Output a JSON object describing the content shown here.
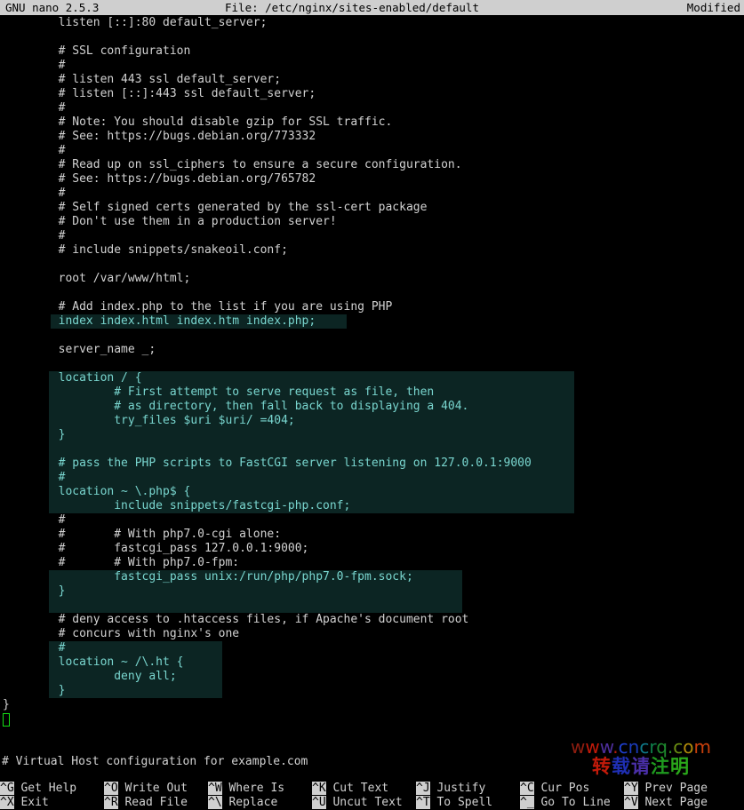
{
  "titlebar": {
    "app": "GNU nano 2.5.3",
    "file": "File: /etc/nginx/sites-enabled/default",
    "state": "Modified"
  },
  "editor": {
    "lines": [
      {
        "text": "        listen [::]:80 default_server;",
        "hl": false
      },
      {
        "text": "",
        "hl": false
      },
      {
        "text": "        # SSL configuration",
        "hl": false
      },
      {
        "text": "        #",
        "hl": false
      },
      {
        "text": "        # listen 443 ssl default_server;",
        "hl": false
      },
      {
        "text": "        # listen [::]:443 ssl default_server;",
        "hl": false
      },
      {
        "text": "        #",
        "hl": false
      },
      {
        "text": "        # Note: You should disable gzip for SSL traffic.",
        "hl": false
      },
      {
        "text": "        # See: https://bugs.debian.org/773332",
        "hl": false
      },
      {
        "text": "        #",
        "hl": false
      },
      {
        "text": "        # Read up on ssl_ciphers to ensure a secure configuration.",
        "hl": false
      },
      {
        "text": "        # See: https://bugs.debian.org/765782",
        "hl": false
      },
      {
        "text": "        #",
        "hl": false
      },
      {
        "text": "        # Self signed certs generated by the ssl-cert package",
        "hl": false
      },
      {
        "text": "        # Don't use them in a production server!",
        "hl": false
      },
      {
        "text": "        #",
        "hl": false
      },
      {
        "text": "        # include snippets/snakeoil.conf;",
        "hl": false
      },
      {
        "text": "",
        "hl": false
      },
      {
        "text": "        root /var/www/html;",
        "hl": false
      },
      {
        "text": "",
        "hl": false
      },
      {
        "text": "        # Add index.php to the list if you are using PHP",
        "hl": false
      },
      {
        "text": "        index index.html index.htm index.php;",
        "hl": true
      },
      {
        "text": "",
        "hl": false
      },
      {
        "text": "        server_name _;",
        "hl": false
      },
      {
        "text": "",
        "hl": false
      },
      {
        "text": "        location / {",
        "hl": true
      },
      {
        "text": "                # First attempt to serve request as file, then",
        "hl": true
      },
      {
        "text": "                # as directory, then fall back to displaying a 404.",
        "hl": true
      },
      {
        "text": "                try_files $uri $uri/ =404;",
        "hl": true
      },
      {
        "text": "        }",
        "hl": true
      },
      {
        "text": "",
        "hl": true
      },
      {
        "text": "        # pass the PHP scripts to FastCGI server listening on 127.0.0.1:9000",
        "hl": true
      },
      {
        "text": "        #",
        "hl": true
      },
      {
        "text": "        location ~ \\.php$ {",
        "hl": true
      },
      {
        "text": "                include snippets/fastcgi-php.conf;",
        "hl": true
      },
      {
        "text": "        #",
        "hl": false
      },
      {
        "text": "        #       # With php7.0-cgi alone:",
        "hl": false
      },
      {
        "text": "        #       fastcgi_pass 127.0.0.1:9000;",
        "hl": false
      },
      {
        "text": "        #       # With php7.0-fpm:",
        "hl": false
      },
      {
        "text": "                fastcgi_pass unix:/run/php/php7.0-fpm.sock;",
        "hl": true
      },
      {
        "text": "        }",
        "hl": true
      },
      {
        "text": "",
        "hl": true
      },
      {
        "text": "        # deny access to .htaccess files, if Apache's document root",
        "hl": false
      },
      {
        "text": "        # concurs with nginx's one",
        "hl": false
      },
      {
        "text": "        #",
        "hl": true
      },
      {
        "text": "        location ~ /\\.ht {",
        "hl": true
      },
      {
        "text": "                deny all;",
        "hl": true
      },
      {
        "text": "        }",
        "hl": true
      },
      {
        "text": "}",
        "hl": false
      },
      {
        "text": "",
        "hl": false
      }
    ],
    "cursor": {
      "line": 49,
      "col": 0
    }
  },
  "statusline": {
    "text": "# Virtual Host configuration for example.com"
  },
  "watermark": {
    "line1": [
      {
        "ch": "w",
        "color": "#8f1d10"
      },
      {
        "ch": "w",
        "color": "#c21a0a"
      },
      {
        "ch": "w",
        "color": "#4f2f9e"
      },
      {
        "ch": ".",
        "color": "#b31b0c"
      },
      {
        "ch": "c",
        "color": "#1f3fcf"
      },
      {
        "ch": "n",
        "color": "#1b3bb9"
      },
      {
        "ch": "c",
        "color": "#0f7a8a"
      },
      {
        "ch": "r",
        "color": "#0f7f4a"
      },
      {
        "ch": "q",
        "color": "#1e8a2e"
      },
      {
        "ch": ".",
        "color": "#2d8a1f"
      },
      {
        "ch": "c",
        "color": "#6c8f12"
      },
      {
        "ch": "o",
        "color": "#b08a0a"
      },
      {
        "ch": "m",
        "color": "#c9400c"
      }
    ],
    "line2": [
      {
        "ch": "转",
        "color": "#c01a0a"
      },
      {
        "ch": "载",
        "color": "#1f2fb5"
      },
      {
        "ch": "请",
        "color": "#4a2fa8"
      },
      {
        "ch": "注",
        "color": "#1f9a1f"
      },
      {
        "ch": "明",
        "color": "#2aa81a"
      }
    ]
  },
  "keybar": {
    "row1": [
      {
        "key": "^G",
        "label": " Get Help"
      },
      {
        "key": "^O",
        "label": " Write Out"
      },
      {
        "key": "^W",
        "label": " Where Is"
      },
      {
        "key": "^K",
        "label": " Cut Text"
      },
      {
        "key": "^J",
        "label": " Justify"
      },
      {
        "key": "^C",
        "label": " Cur Pos"
      },
      {
        "key": "^Y",
        "label": " Prev Page"
      }
    ],
    "row2": [
      {
        "key": "^X",
        "label": " Exit"
      },
      {
        "key": "^R",
        "label": " Read File"
      },
      {
        "key": "^\\",
        "label": " Replace"
      },
      {
        "key": "^U",
        "label": " Uncut Text"
      },
      {
        "key": "^T",
        "label": " To Spell"
      },
      {
        "key": "^_",
        "label": " Go To Line"
      },
      {
        "key": "^V",
        "label": " Next Page"
      }
    ]
  },
  "colors": {
    "titlebar_bg": "#cfcfcf",
    "body_bg": "#000000",
    "text": "#d2d2d2",
    "highlight_bg": "#0c2523",
    "highlight_text": "#79d6cf",
    "cursor": "#14e014",
    "key_badge_bg": "#cfcfcf"
  }
}
